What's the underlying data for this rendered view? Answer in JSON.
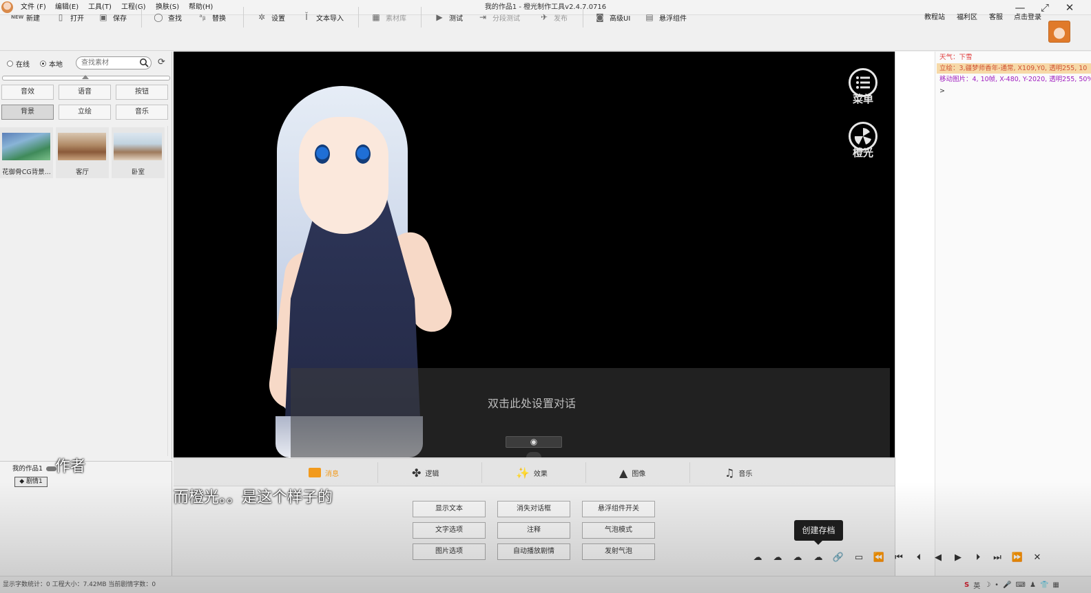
{
  "window": {
    "title": "我的作品1 - 橙光制作工具v2.4.7.0716",
    "minimize": "—",
    "maximize": "⤢",
    "close": "✕"
  },
  "menubar": {
    "items": [
      "文件 (F)",
      "编辑(E)",
      "工具(T)",
      "工程(G)",
      "换肤(S)",
      "帮助(H)"
    ]
  },
  "toolbar": {
    "new": "新建",
    "open": "打开",
    "save": "保存",
    "find": "查找",
    "replace": "替换",
    "settings": "设置",
    "text_import": "文本导入",
    "asset_library": "素材库",
    "test": "测试",
    "segment_test": "分段测试",
    "publish": "发布",
    "advanced_ui": "高级UI",
    "floating_widget": "悬浮组件",
    "right_links": [
      "教程站",
      "福利区",
      "客服",
      "点击登录"
    ]
  },
  "assets": {
    "source_online": "在线",
    "source_local": "本地",
    "search_placeholder": "查找素材",
    "categories": [
      "音效",
      "语音",
      "按钮",
      "背景",
      "立绘",
      "音乐"
    ],
    "active_category": "背景",
    "thumbnails": [
      {
        "label": "花御骨CG背景..."
      },
      {
        "label": "客厅"
      },
      {
        "label": "卧室"
      }
    ]
  },
  "project_tree": {
    "project": "我的作品1",
    "episode": "剧情1"
  },
  "stage": {
    "dialog_placeholder": "双击此处设置对话",
    "hide_dialog_icon": "eye-slash-icon",
    "menu_label": "菜单",
    "brand_label": "橙光"
  },
  "event_log": [
    {
      "text": "天气：下雪",
      "color": "#e04040",
      "highlight": false
    },
    {
      "text": "立绘：3,疆梦师香年-通常, X109,Y0, 透明255, 10",
      "color": "#d05030",
      "highlight": true
    },
    {
      "text": "移动图片：4, 10帧, X-480, Y-2020, 透明255, 50%",
      "color": "#a020c0",
      "highlight": false
    },
    {
      "text": ">",
      "color": "#333333",
      "highlight": false
    }
  ],
  "command_tabs": {
    "tabs": [
      "消息",
      "逻辑",
      "效果",
      "图像",
      "音乐"
    ],
    "active": "消息",
    "active_color": "#f29a1c"
  },
  "commands": [
    [
      "显示文本",
      "消失对话框",
      "悬浮组件开关"
    ],
    [
      "文字选项",
      "注释",
      "气泡模式"
    ],
    [
      "图片选项",
      "自动播放剧情",
      "发射气泡"
    ]
  ],
  "playback": {
    "tooltip": "创建存档",
    "controls": [
      "cloud-upload-icon",
      "cloud-download-icon",
      "cloud-icon",
      "cloud-save-icon",
      "link-icon",
      "screen-icon",
      "rewind-icon",
      "skip-start-icon",
      "step-start-icon",
      "prev-icon",
      "next-icon",
      "step-end-icon",
      "skip-end-icon",
      "fast-forward-icon",
      "close-icon"
    ],
    "glyphs": [
      "☁",
      "☁",
      "☁",
      "☁",
      "🔗",
      "▭",
      "⏪",
      "⏮",
      "⏴",
      "◀",
      "▶",
      "⏵",
      "⏭",
      "⏩",
      "✕"
    ]
  },
  "subtitles": {
    "author": "作者",
    "line": "而橙光。。是这个样子的"
  },
  "status": {
    "text": "显示字数统计：0 工程大小：7.42MB 当前剧情字数：0"
  }
}
